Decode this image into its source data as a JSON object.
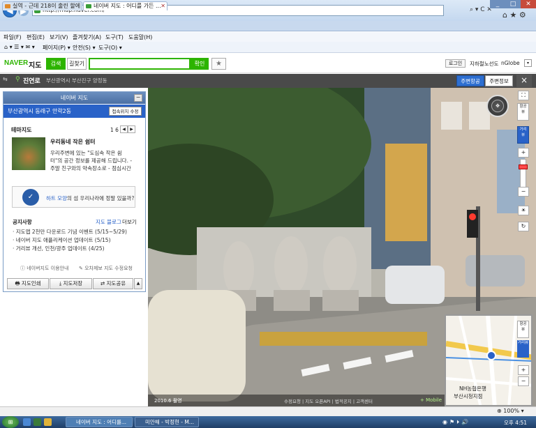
{
  "browser": {
    "url": "http://map.naver.com/",
    "tabs": [
      {
        "label": "실역 - 근데 218이 출린 할에 ...",
        "active": false
      },
      {
        "label": "네이버 지도 : 어디를 가든 ...",
        "active": true
      }
    ],
    "menu": [
      "파일(F)",
      "편집(E)",
      "보기(V)",
      "즐겨찾기(A)",
      "도구(T)",
      "도움말(H)"
    ],
    "commands": [
      "페이지(P) ▾",
      "안전(S) ▾",
      "도구(O) ▾"
    ],
    "zoom": "100%"
  },
  "naver": {
    "logo": "NAVER",
    "service": "지도",
    "search_tab": "검색",
    "route_tab": "길찾기",
    "search_value": "",
    "search_button": "확인",
    "favorite_icon": "★",
    "login": "로그인",
    "subway": "지하철노선도",
    "nglobe": "nGlobe"
  },
  "location": {
    "name": "진연로",
    "address": "부산광역시 부산진구 양정동",
    "btn_around": "주변항공",
    "btn_info": "주변정보",
    "close": "×"
  },
  "panel": {
    "title": "네이버 지도",
    "region": "부산광역시 동래구 안락2동",
    "region_button": "접속위치 수정",
    "theme_title": "테마지도",
    "theme_page": "1 6",
    "theme_head": "우리동네 작은 쉼터",
    "theme_lines": [
      "우리주변에 있는 \"도심속 작은 쉼",
      "터\"의 공간 정보를 제공해 드립니다. -",
      "주말 친구와의 약속장소로 - 점심시간"
    ],
    "banner_highlight": "하트 모양",
    "banner_text": "의 섬 우리나라에 정말 있을까?",
    "notice_title": "공지사항",
    "notice_blog": "지도 블로그",
    "notice_more": "더보기",
    "notices": [
      "· 지도앱 2천만 다운로드 기념 이벤트 (5/15~5/29)",
      "· 네이버 지도 애플리케이션 업데이트 (5/15)",
      "· 거리뷰 개선, 인천/광주 업데이트 (4/25)"
    ],
    "help_guide": "네이버지도 이용안내",
    "help_report": "오차제보 지도 수정요청",
    "btn_print": "지도인쇄",
    "btn_save": "지도저장",
    "btn_share": "지도공유"
  },
  "view": {
    "date": "2010.6 촬영",
    "footer": "수정요청 | 지도 오픈API | 법적공지 | 고객센터",
    "mobile": "+ Mobile",
    "aerial_label": "항공뷰",
    "street_label": "거리뷰",
    "minimap_label1": "NH농협은행",
    "minimap_label2": "부산시청지점"
  },
  "taskbar": {
    "tasks": [
      "네이버 지도 : 어디를...",
      "미안해 - 박정현 - M..."
    ],
    "time": "오후 4:51"
  },
  "colors": {
    "naver_green": "#2db400",
    "naver_blue": "#2962c8"
  }
}
